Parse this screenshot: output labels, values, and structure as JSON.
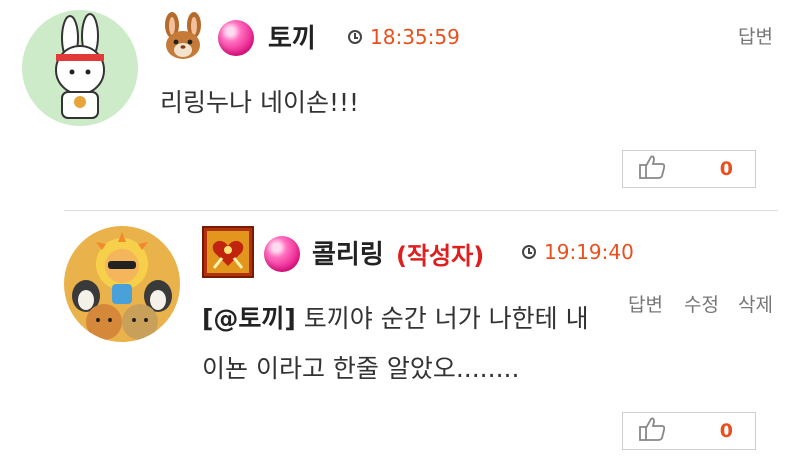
{
  "comments": [
    {
      "nickname": "토끼",
      "time": "18:35:59",
      "body": "리링누나 네이손!!!",
      "actions": [
        "답변"
      ],
      "likes": "0"
    },
    {
      "nickname": "콜리링",
      "author_tag": "(작성자)",
      "time": "19:19:40",
      "mention": "[@토끼]",
      "body_line1": " 토끼야 순간 너가 나한테 내",
      "body_line2": "이뇬 이라고 한줄 알았오........",
      "actions": [
        "답변",
        "수정",
        "삭제"
      ],
      "likes": "0"
    }
  ]
}
